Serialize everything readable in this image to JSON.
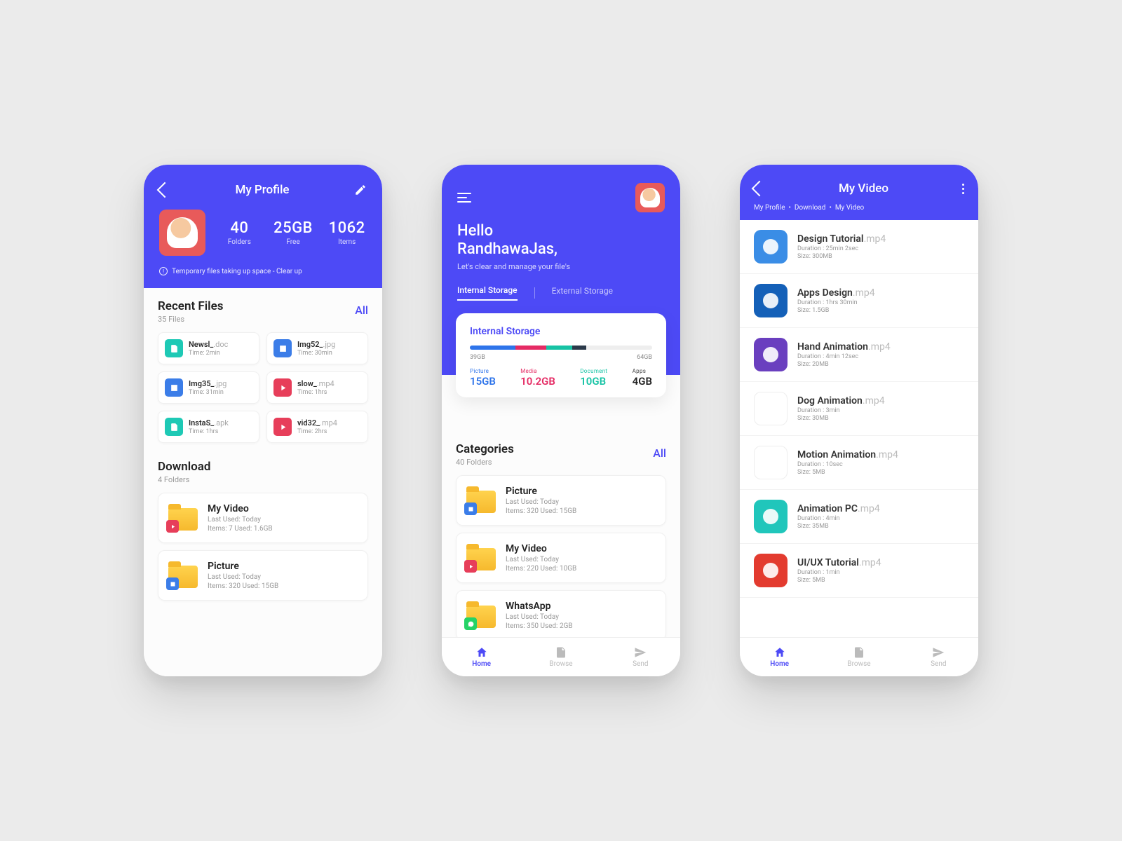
{
  "screen1": {
    "title": "My Profile",
    "stats": {
      "folders_val": "40",
      "folders_lbl": "Folders",
      "free_val": "25GB",
      "free_lbl": "Free",
      "items_val": "1062",
      "items_lbl": "Items"
    },
    "warning": "Temporary files taking up space - Clear up",
    "recent": {
      "title": "Recent Files",
      "sub": "35 Files",
      "link": "All",
      "files": [
        {
          "name": "Newsl_",
          "ext": ".doc",
          "time": "Time: 2min",
          "type": "doc"
        },
        {
          "name": "Img52_",
          "ext": ".jpg",
          "time": "Time: 30min",
          "type": "img"
        },
        {
          "name": "Img35_",
          "ext": ".jpg",
          "time": "Time: 31min",
          "type": "img"
        },
        {
          "name": "slow_",
          "ext": ".mp4",
          "time": "Time: 1hrs",
          "type": "vid"
        },
        {
          "name": "InstaS_",
          "ext": ".apk",
          "time": "Time: 1hrs",
          "type": "doc"
        },
        {
          "name": "vid32_",
          "ext": ".mp4",
          "time": "Time: 2hrs",
          "type": "vid"
        }
      ]
    },
    "download": {
      "title": "Download",
      "sub": "4 Folders",
      "folders": [
        {
          "name": "My Video",
          "last": "Last Used: Today",
          "detail": "Items: 7    Used: 1.6GB",
          "badge": "vid"
        },
        {
          "name": "Picture",
          "last": "Last Used: Today",
          "detail": "Items: 320  Used: 15GB",
          "badge": "img"
        }
      ]
    }
  },
  "screen2": {
    "hello1": "Hello",
    "hello2": "RandhawaJas,",
    "sub": "Let's clear and manage your file's",
    "tabs": {
      "t1": "Internal Storage",
      "t2": "External Storage"
    },
    "storage": {
      "title": "Internal Storage",
      "used": "39GB",
      "total": "64GB",
      "cats": [
        {
          "lbl": "Picture",
          "val": "15GB",
          "cls": "c-pic"
        },
        {
          "lbl": "Media",
          "val": "10.2GB",
          "cls": "c-med"
        },
        {
          "lbl": "Document",
          "val": "10GB",
          "cls": "c-doc"
        },
        {
          "lbl": "Apps",
          "val": "4GB",
          "cls": "c-app"
        }
      ]
    },
    "categories": {
      "title": "Categories",
      "sub": "40 Folders",
      "link": "All",
      "folders": [
        {
          "name": "Picture",
          "last": "Last Used: Today",
          "detail": "Items: 320  Used: 15GB",
          "badge": "img"
        },
        {
          "name": "My Video",
          "last": "Last Used: Today",
          "detail": "Items: 220  Used: 10GB",
          "badge": "vid"
        },
        {
          "name": "WhatsApp",
          "last": "Last Used: Today",
          "detail": "Items: 350  Used: 2GB",
          "badge": "wa"
        }
      ]
    },
    "nav": {
      "home": "Home",
      "browse": "Browse",
      "send": "Send"
    }
  },
  "screen3": {
    "title": "My Video",
    "crumb": {
      "a": "My Profile",
      "b": "Download",
      "c": "My Video"
    },
    "videos": [
      {
        "name": "Design Tutorial",
        "ext": ".mp4",
        "dur": "Duration : 25min 2sec",
        "size": "Size: 300MB",
        "t": "t1"
      },
      {
        "name": "Apps Design",
        "ext": ".mp4",
        "dur": "Duration : 1hrs 30min",
        "size": "Size: 1.5GB",
        "t": "t2"
      },
      {
        "name": "Hand Animation",
        "ext": ".mp4",
        "dur": "Duration : 4min 12sec",
        "size": "Size: 20MB",
        "t": "t3"
      },
      {
        "name": "Dog Animation",
        "ext": ".mp4",
        "dur": "Duration : 3min",
        "size": "Size: 30MB",
        "t": "t4"
      },
      {
        "name": "Motion Animation",
        "ext": ".mp4",
        "dur": "Duration : 10sec",
        "size": "Size: 5MB",
        "t": "t5"
      },
      {
        "name": "Animation PC",
        "ext": ".mp4",
        "dur": "Duration : 4min",
        "size": "Size: 35MB",
        "t": "t6"
      },
      {
        "name": "UI/UX Tutorial",
        "ext": ".mp4",
        "dur": "Duration : 1min",
        "size": "Size: 5MB",
        "t": "t7"
      }
    ]
  }
}
